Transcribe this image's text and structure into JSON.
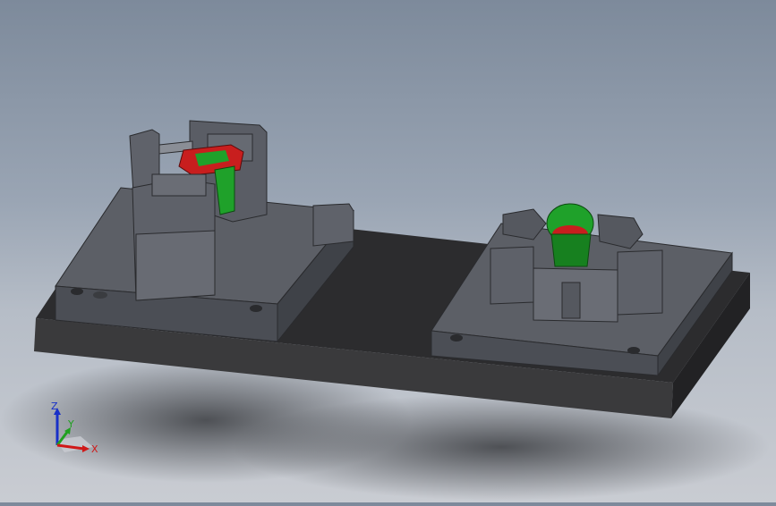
{
  "viewport": {
    "scene": "fixture-assembly-isometric-view",
    "colors": {
      "background_top": "#7d8a9b",
      "background_bottom": "#c9ccd2",
      "base_plate": "#2f2f31",
      "fixture_plate": "#5b5e66",
      "part_green": "#1fa12a",
      "part_red": "#c81e1e"
    }
  },
  "triad": {
    "x_label": "X",
    "y_label": "Y",
    "z_label": "Z",
    "colors": {
      "x": "#d01818",
      "y": "#20a020",
      "z": "#1830c8"
    }
  }
}
